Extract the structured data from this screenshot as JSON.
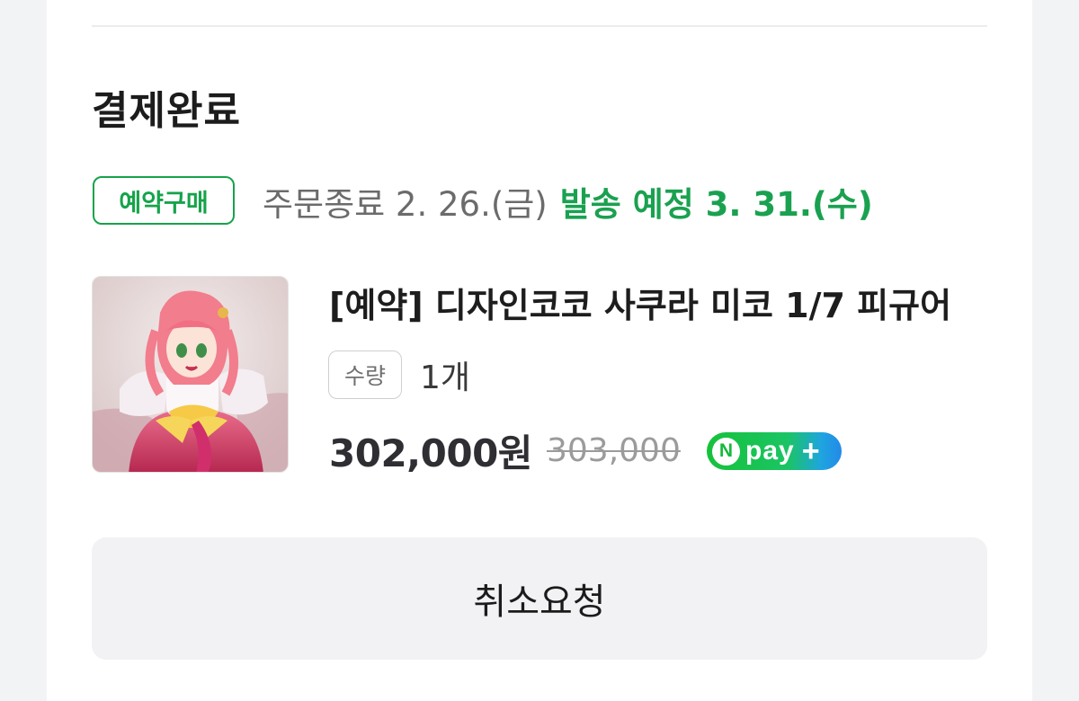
{
  "order": {
    "status_title": "결제완료",
    "reserve_badge": "예약구매",
    "order_end": "주문종료 2. 26.(금)",
    "ship_date": "발송 예정 3. 31.(수)"
  },
  "product": {
    "name": "[예약] 디자인코코 사쿠라 미코 1/7 피규어",
    "quantity_label": "수량",
    "quantity_value": "1개",
    "sale_price": "302,000원",
    "original_price": "303,000",
    "pay_badge": {
      "circle": "N",
      "text": "pay",
      "plus": "+"
    }
  },
  "actions": {
    "cancel_label": "취소요청"
  },
  "colors": {
    "accent_green": "#1aa150",
    "badge_green": "#16a34a",
    "npay_green": "#16c23a",
    "npay_blue": "#238ae8"
  },
  "icons": {
    "pay_badge": "npay-plus-logo",
    "thumbnail": "product-figure-image"
  }
}
